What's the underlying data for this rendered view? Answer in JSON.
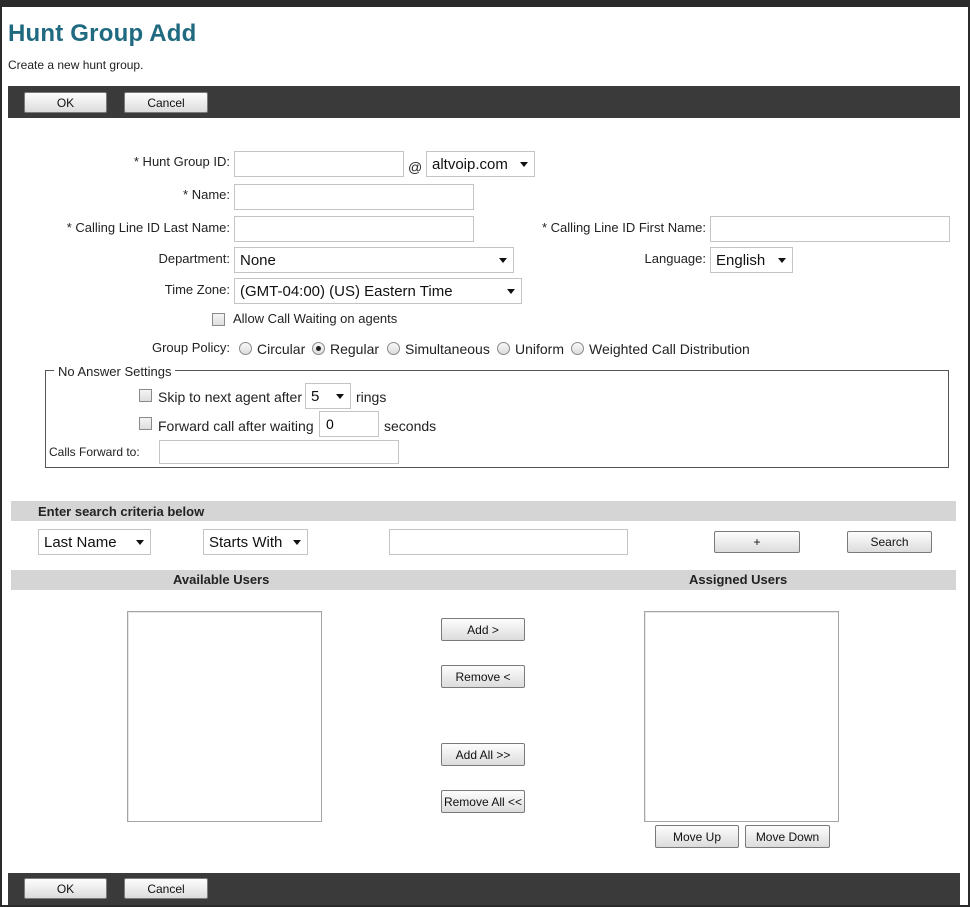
{
  "page": {
    "title": "Hunt Group Add",
    "subtitle": "Create a new hunt group."
  },
  "toolbar": {
    "ok_label": "OK",
    "cancel_label": "Cancel"
  },
  "form": {
    "hunt_group_id": {
      "label": "* Hunt Group ID:",
      "value": "",
      "at": "@",
      "domain": "altvoip.com"
    },
    "name": {
      "label": "* Name:",
      "value": ""
    },
    "clid_last": {
      "label": "* Calling Line ID Last Name:",
      "value": ""
    },
    "clid_first": {
      "label": "* Calling Line ID First Name:",
      "value": ""
    },
    "department": {
      "label": "Department:",
      "value": "None"
    },
    "language": {
      "label": "Language:",
      "value": "English"
    },
    "time_zone": {
      "label": "Time Zone:",
      "value": "(GMT-04:00) (US) Eastern Time"
    },
    "allow_call_waiting": {
      "label": "Allow Call Waiting on agents",
      "checked": false
    },
    "group_policy": {
      "label": "Group Policy:",
      "options": [
        "Circular",
        "Regular",
        "Simultaneous",
        "Uniform",
        "Weighted Call Distribution"
      ],
      "selected": "Regular"
    }
  },
  "no_answer": {
    "legend": "No Answer Settings",
    "skip": {
      "label": "Skip to next agent after",
      "value": "5",
      "suffix": "rings",
      "checked": false
    },
    "forward": {
      "label": "Forward call after waiting",
      "value": "0",
      "suffix": "seconds",
      "checked": false
    },
    "calls_forward_to": {
      "label": "Calls Forward to:",
      "value": ""
    }
  },
  "search": {
    "header": "Enter search criteria below",
    "field": "Last Name",
    "mode": "Starts With",
    "value": "",
    "plus_label": "+",
    "search_label": "Search"
  },
  "users": {
    "available_header": "Available Users",
    "assigned_header": "Assigned Users",
    "add_label": "Add >",
    "remove_label": "Remove <",
    "add_all_label": "Add All >>",
    "remove_all_label": "Remove All <<",
    "move_up_label": "Move Up",
    "move_down_label": "Move Down"
  },
  "colors": {
    "title": "#1f6a80",
    "toolbar": "#3a3a3a",
    "section_bar": "#d5d5d5"
  }
}
